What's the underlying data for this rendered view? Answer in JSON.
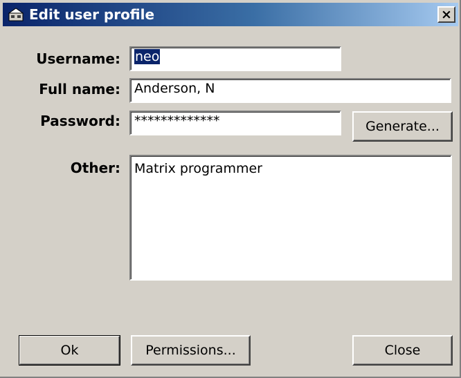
{
  "window": {
    "title": "Edit user profile",
    "title_icon": "key-icon",
    "close_label": "×"
  },
  "form": {
    "username_label": "Username:",
    "username_value": "neo",
    "fullname_label": "Full name:",
    "fullname_value": "Anderson, N",
    "password_label": "Password:",
    "password_value": "*************",
    "generate_label": "Generate...",
    "other_label": "Other:",
    "other_value": "Matrix programmer"
  },
  "buttons": {
    "ok_label": "Ok",
    "permissions_label": "Permissions...",
    "close_label": "Close"
  },
  "colors": {
    "titlebar_start": "#0a246a",
    "titlebar_end": "#a6caf0",
    "dialog_face": "#d4d0c8",
    "selection": "#0a246a"
  }
}
